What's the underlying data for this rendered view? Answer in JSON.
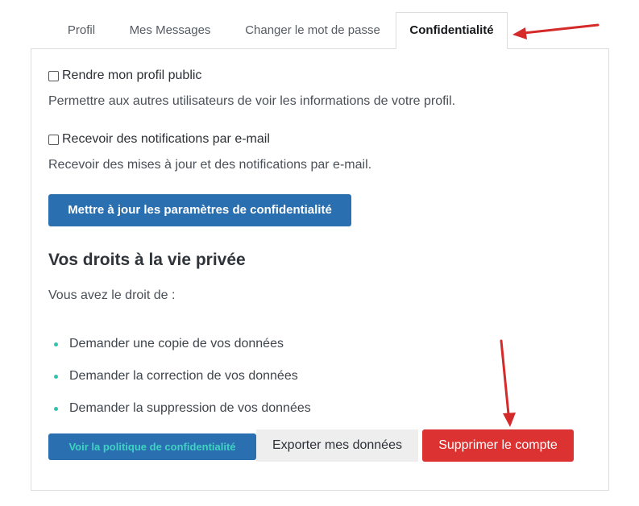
{
  "tabs": [
    {
      "label": "Profil"
    },
    {
      "label": "Mes Messages"
    },
    {
      "label": "Changer le mot de passe"
    },
    {
      "label": "Confidentialité",
      "active": true
    }
  ],
  "privacy": {
    "public_profile_label": "Rendre mon profil public",
    "public_profile_checked": false,
    "public_profile_desc": "Permettre aux autres utilisateurs de voir les informations de votre profil.",
    "email_notifications_label": "Recevoir des notifications par e-mail",
    "email_notifications_checked": false,
    "email_notifications_desc": "Recevoir des mises à jour et des notifications par e-mail.",
    "update_button": "Mettre à jour les paramètres de confidentialité"
  },
  "rights": {
    "heading": "Vos droits à la vie privée",
    "intro": "Vous avez le droit de :",
    "items": [
      "Demander une copie de vos données",
      "Demander la correction de vos données",
      "Demander la suppression de vos données"
    ]
  },
  "actions": {
    "policy_button": "Voir la politique de confidentialité",
    "export_button": "Exporter mes données",
    "delete_button": "Supprimer le compte"
  },
  "colors": {
    "primary": "#2a6fb0",
    "danger": "#dd3232",
    "accent": "#2fc4b0",
    "annotation_arrow": "#d42a2a"
  }
}
